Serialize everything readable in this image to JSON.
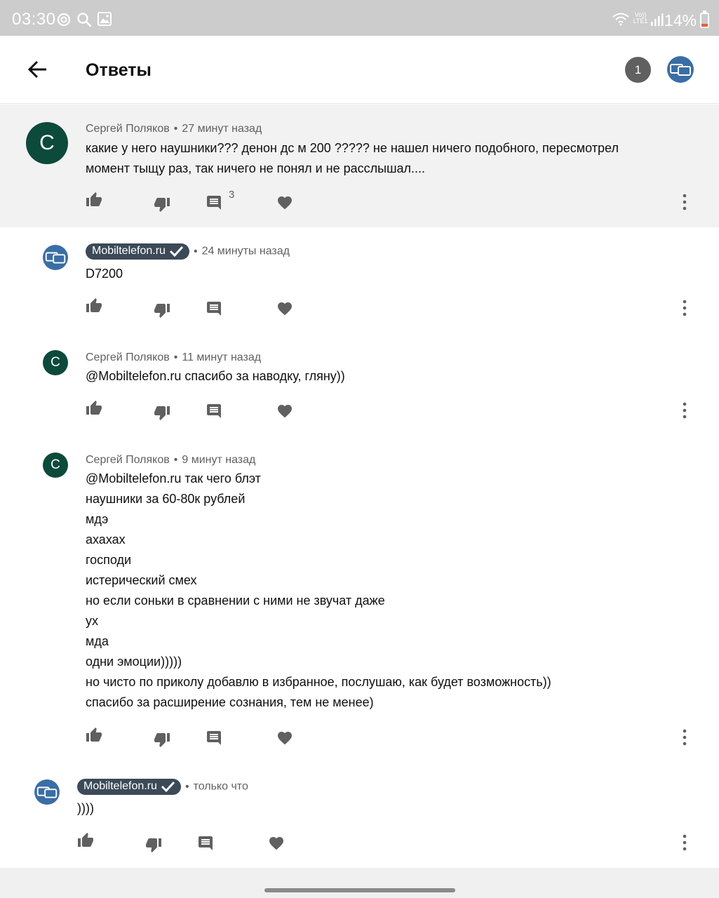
{
  "status_bar": {
    "time": "03:30",
    "battery": "14%",
    "network_label": "Vo)) LTE1"
  },
  "app_bar": {
    "title": "Ответы",
    "counter": "1",
    "back_icon": "arrow-left-icon",
    "channel_avatar_icon": "mobiltelefon-logo-icon"
  },
  "comments": [
    {
      "author": "Сергей Поляков",
      "time": "27 минут назад",
      "text": "какие у него наушники??? денон дс м 200 ????? не нашел ничего подобного, пересмотрел\nмомент тыщу раз, так ничего не понял и не расслышал....",
      "reply_count": "3",
      "avatar_letter": "С"
    },
    {
      "author": "Mobiltelefon.ru",
      "time": "24 минуты назад",
      "text": "D7200"
    },
    {
      "author": "Сергей Поляков",
      "time": "11 минут назад",
      "text": "@Mobiltelefon.ru спасибо за наводку, гляну))",
      "avatar_letter": "С"
    },
    {
      "author": "Сергей Поляков",
      "time": "9 минут назад",
      "text": "@Mobiltelefon.ru так чего блэт\nнаушники за 60-80к рублей\nмдэ\nахахах\nгосподи\nистерический смех\nно если соньки в сравнении с ними не звучат даже\nух\nмда\nодни эмоции)))))\nно чисто по приколу добавлю в избранное, послушаю, как будет возможность))\nспасибо за расширение сознания, тем не менее)",
      "avatar_letter": "С"
    },
    {
      "author": "Mobiltelefon.ru",
      "time": "только что",
      "text": "))))"
    }
  ],
  "colors": {
    "status_bar_bg": "#cccccc",
    "highlight_bg": "#f2f2f2",
    "avatar_green": "#0c4a3c",
    "avatar_blue": "#3a6ea5",
    "owner_badge_bg": "#3c4a58",
    "icon_gray": "#606060",
    "battery_low": "#e85b3a"
  }
}
